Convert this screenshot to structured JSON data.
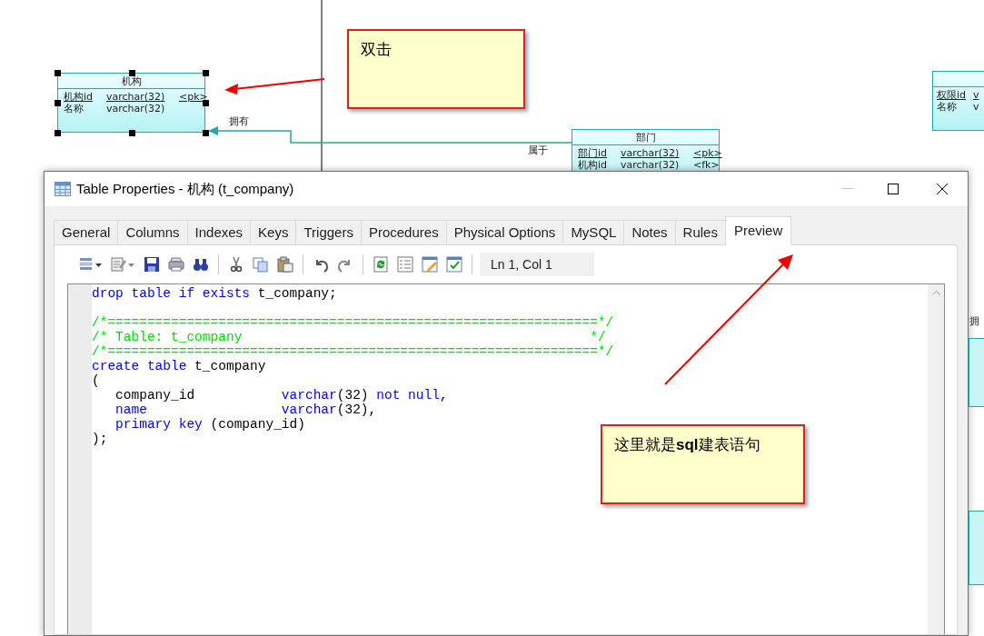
{
  "diagram": {
    "entities": [
      {
        "title": "机构",
        "selected": true,
        "attributes": [
          {
            "name": "机构id",
            "type": "varchar(32)",
            "key": "<pk>",
            "primary": true
          },
          {
            "name": "名称",
            "type": "varchar(32)",
            "primary": false
          }
        ]
      },
      {
        "title": "部门",
        "selected": false,
        "attributes": [
          {
            "name": "部门id",
            "type": "varchar(32)",
            "key": "<pk>",
            "primary": true
          },
          {
            "name": "机构id",
            "type": "varchar(32)",
            "key": "<fk>",
            "primary": false
          }
        ]
      },
      {
        "selected": false,
        "attributes": [
          {
            "name": "权限id",
            "type": "v",
            "primary": true
          },
          {
            "name": "名称",
            "type": "v",
            "primary": false
          }
        ]
      }
    ],
    "relations": [
      {
        "label": "拥有"
      },
      {
        "label": "属于"
      },
      {
        "label": "拥"
      }
    ],
    "callouts": [
      {
        "text": "双击"
      },
      {
        "text": "这里就是**sql**建表语句"
      }
    ]
  },
  "dialog": {
    "title": "Table Properties - 机构 (t_company)",
    "tabs": [
      {
        "label": "General",
        "selected": false
      },
      {
        "label": "Columns",
        "selected": false
      },
      {
        "label": "Indexes",
        "selected": false
      },
      {
        "label": "Keys",
        "selected": false
      },
      {
        "label": "Triggers",
        "selected": false
      },
      {
        "label": "Procedures",
        "selected": false
      },
      {
        "label": "Physical Options",
        "selected": false
      },
      {
        "label": "MySQL",
        "selected": false
      },
      {
        "label": "Notes",
        "selected": false
      },
      {
        "label": "Rules",
        "selected": false
      },
      {
        "label": "Preview",
        "selected": true
      }
    ],
    "cursor_position": "Ln 1, Col 1",
    "code_lines": [
      {
        "kind": "code",
        "tokens": [
          {
            "kind": "keyword",
            "text": "drop table if exists"
          },
          {
            "kind": "plain",
            "text": " t_company;"
          }
        ]
      },
      {
        "kind": "blank"
      },
      {
        "kind": "code",
        "tokens": [
          {
            "kind": "comment",
            "text": "/*==============================================================*/"
          }
        ]
      },
      {
        "kind": "code",
        "tokens": [
          {
            "kind": "comment",
            "text": "/* Table: t_company                                            */"
          }
        ]
      },
      {
        "kind": "code",
        "tokens": [
          {
            "kind": "comment",
            "text": "/*==============================================================*/"
          }
        ]
      },
      {
        "kind": "code",
        "tokens": [
          {
            "kind": "keyword",
            "text": "create table"
          },
          {
            "kind": "plain",
            "text": " t_company"
          }
        ]
      },
      {
        "kind": "code",
        "tokens": [
          {
            "kind": "plain",
            "text": "("
          }
        ]
      },
      {
        "kind": "code",
        "tokens": [
          {
            "kind": "plain",
            "text": "   company_id           "
          },
          {
            "kind": "keyword",
            "text": "varchar"
          },
          {
            "kind": "plain",
            "text": "(32) "
          },
          {
            "kind": "keyword",
            "text": "not null"
          },
          {
            "kind": "plain",
            "text": ","
          }
        ]
      },
      {
        "kind": "code",
        "tokens": [
          {
            "kind": "keyword",
            "text": "   name                 varchar"
          },
          {
            "kind": "plain",
            "text": "(32),"
          }
        ]
      },
      {
        "kind": "code",
        "tokens": [
          {
            "kind": "keyword",
            "text": "   primary key"
          },
          {
            "kind": "plain",
            "text": " (company_id)"
          }
        ]
      },
      {
        "kind": "code",
        "tokens": [
          {
            "kind": "plain",
            "text": ");"
          }
        ]
      }
    ]
  }
}
